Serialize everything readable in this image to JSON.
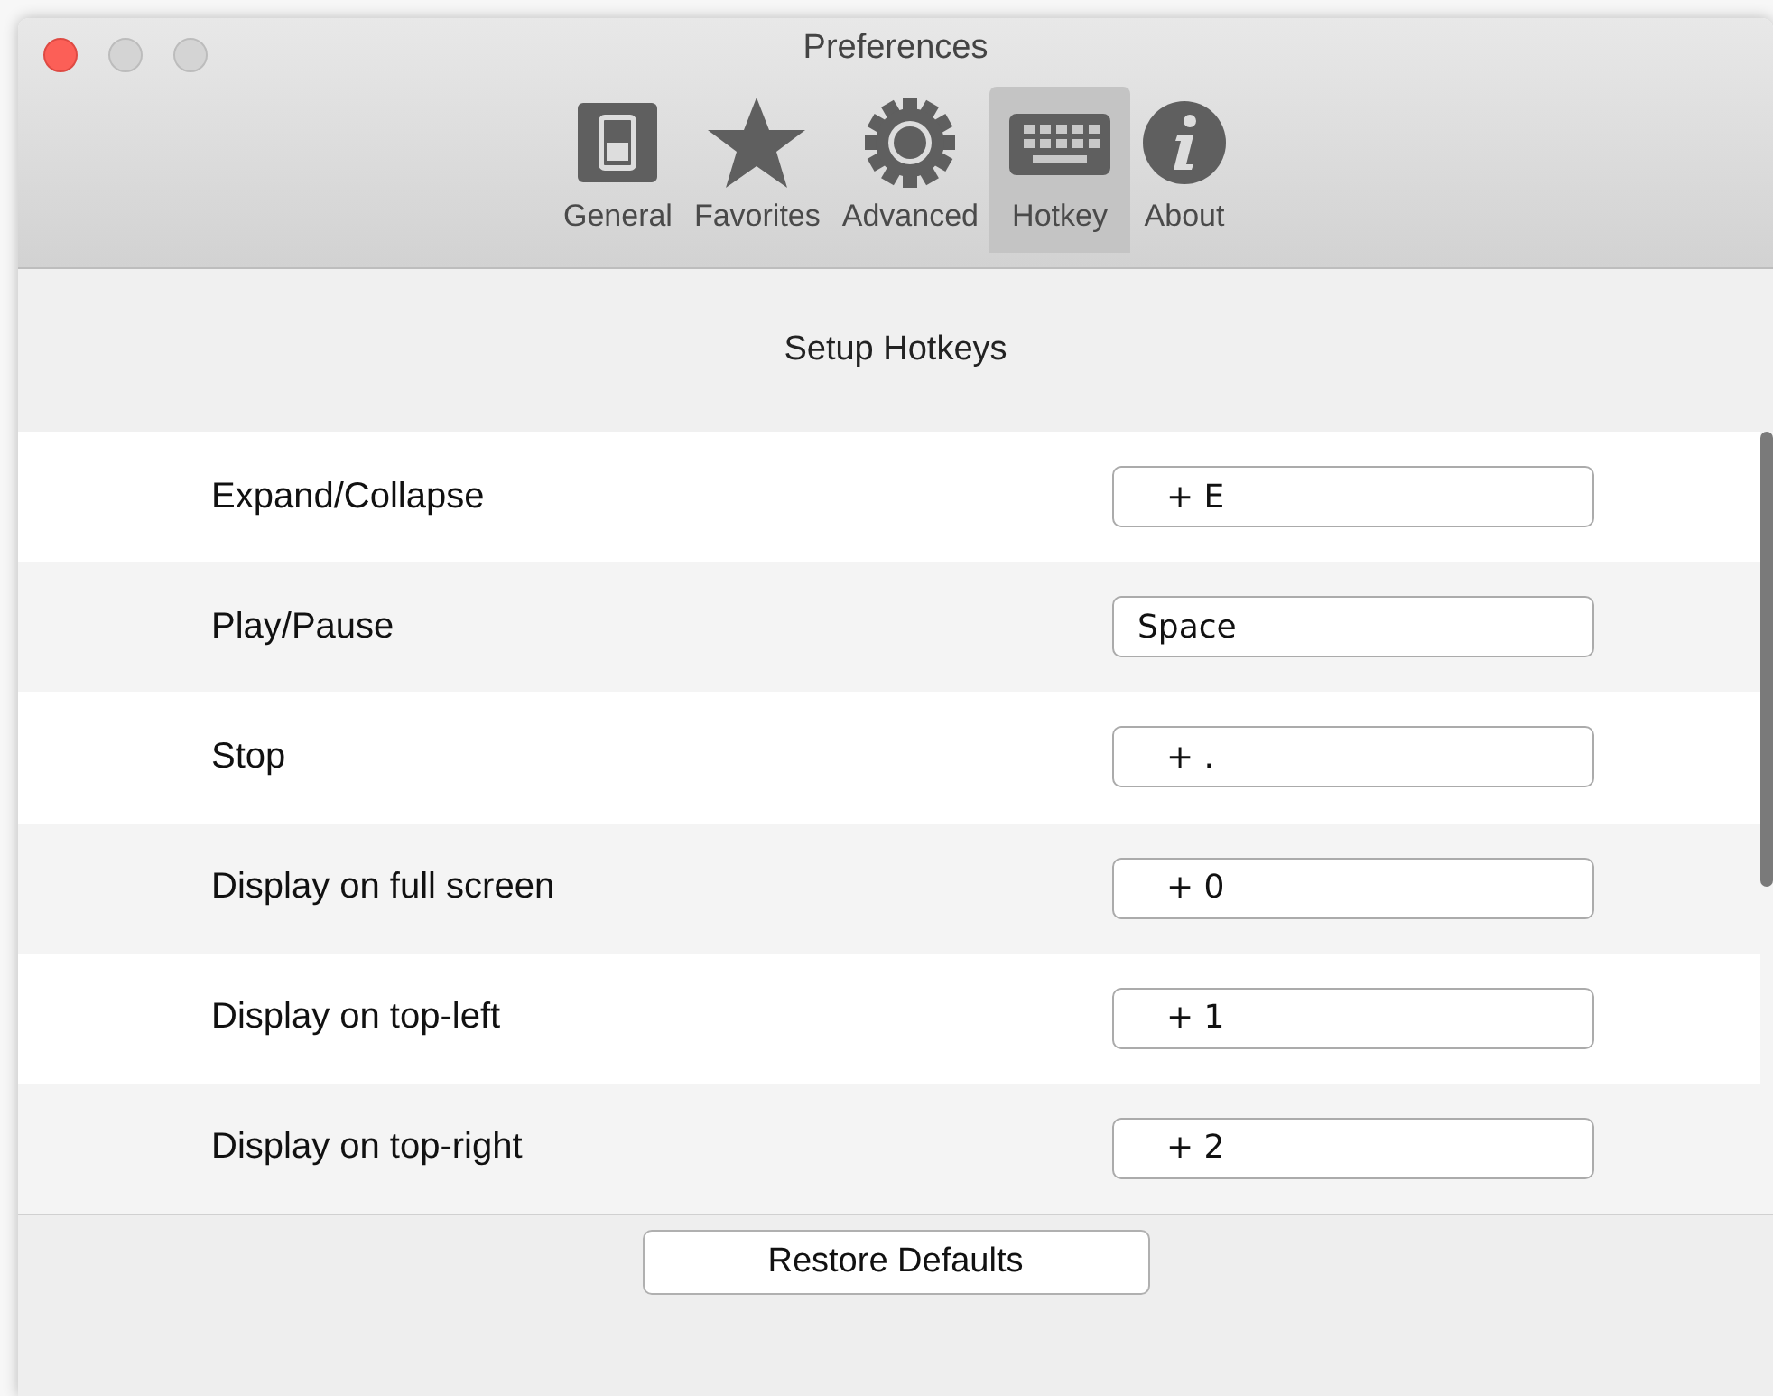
{
  "window": {
    "title": "Preferences"
  },
  "tabs": [
    {
      "label": "General",
      "kind": "switch",
      "selected": false
    },
    {
      "label": "Favorites",
      "kind": "star",
      "selected": false
    },
    {
      "label": "Advanced",
      "kind": "gear",
      "selected": false
    },
    {
      "label": "Hotkey",
      "kind": "keyboard",
      "selected": true
    },
    {
      "label": "About",
      "kind": "info",
      "selected": false
    }
  ],
  "section_title": "Setup Hotkeys",
  "hotkeys": [
    {
      "label": "Expand/Collapse",
      "value": "+ E",
      "kind": "combo"
    },
    {
      "label": "Play/Pause",
      "value": "Space",
      "kind": "key"
    },
    {
      "label": "Stop",
      "value": "+ .",
      "kind": "combo"
    },
    {
      "label": "Display on full screen",
      "value": "+ 0",
      "kind": "combo"
    },
    {
      "label": "Display on top-left",
      "value": "+ 1",
      "kind": "combo"
    },
    {
      "label": "Display on top-right",
      "value": "+ 2",
      "kind": "combo"
    }
  ],
  "buttons": [
    "Restore Defaults"
  ]
}
